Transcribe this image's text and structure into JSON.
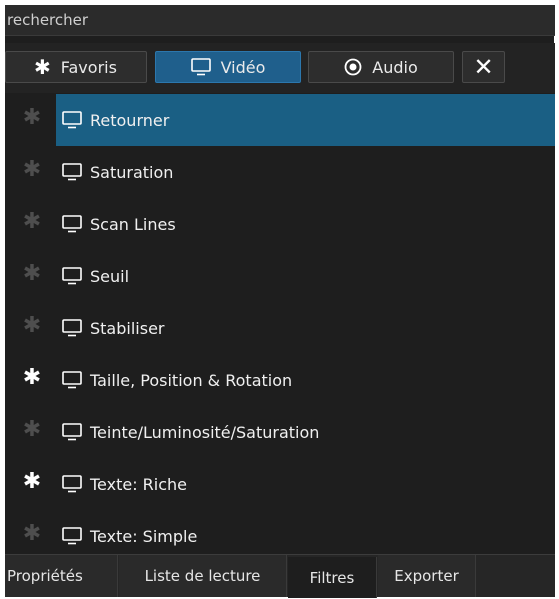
{
  "search": {
    "placeholder": "rechercher"
  },
  "toolbar": {
    "favoris_label": "Favoris",
    "video_label": "Vidéo",
    "audio_label": "Audio",
    "close_symbol": "✕"
  },
  "icons": {
    "favorite": "star-icon",
    "video": "monitor-icon",
    "audio": "radio-button-icon",
    "close": "close-icon"
  },
  "filters": [
    {
      "label": "Retourner",
      "favorite": false,
      "selected": true
    },
    {
      "label": "Saturation",
      "favorite": false,
      "selected": false
    },
    {
      "label": "Scan Lines",
      "favorite": false,
      "selected": false
    },
    {
      "label": "Seuil",
      "favorite": false,
      "selected": false
    },
    {
      "label": "Stabiliser",
      "favorite": false,
      "selected": false
    },
    {
      "label": "Taille, Position & Rotation",
      "favorite": true,
      "selected": false
    },
    {
      "label": "Teinte/Luminosité/Saturation",
      "favorite": false,
      "selected": false
    },
    {
      "label": "Texte: Riche",
      "favorite": true,
      "selected": false
    },
    {
      "label": "Texte: Simple",
      "favorite": false,
      "selected": false
    }
  ],
  "tabs": [
    {
      "label": "Propriétés",
      "active": false
    },
    {
      "label": "Liste de lecture",
      "active": false
    },
    {
      "label": "Filtres",
      "active": true
    },
    {
      "label": "Exporter",
      "active": false
    }
  ],
  "colors": {
    "accent": "#1a5f84",
    "active_button": "#1f5f8c",
    "background": "#1e1e1e",
    "favorite_star_on": "#ffffff",
    "favorite_star_off": "#4e4e4e"
  }
}
